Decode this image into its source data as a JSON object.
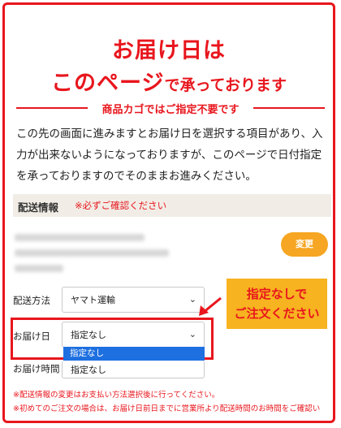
{
  "header": {
    "line1": "お届け日は",
    "line2_main": "このページ",
    "line2_small": "で承っております"
  },
  "divider": {
    "text": "商品カゴではご指定不要です"
  },
  "description": "この先の画面に進みますとお届け日を選択する項目があり、入力が出来ないようになっておりますが、このページで日付指定を承っておりますのでそのままお進みください。",
  "shipping_info": {
    "title": "配送情報",
    "note": "※必ずご確認ください",
    "change_button": "変更"
  },
  "form": {
    "method_label": "配送方法",
    "method_value": "ヤマト運輸",
    "date_label": "お届け日",
    "date_value": "指定なし",
    "date_option": "指定なし",
    "time_label": "お届け時間",
    "time_value": "指定なし"
  },
  "callout": {
    "line1": "指定なしで",
    "line2": "ご注文ください"
  },
  "notes": {
    "note1": "※配送情報の変更はお支払い方法選択後に行ってください。",
    "note2": "※初めてのご注文の場合は、お届け日前日までに営業所より配送時間のお時間をご確認い"
  },
  "colors": {
    "accent": "#e8161d",
    "button": "#f6a623",
    "callout_bg": "#f7b320",
    "selected": "#1e6fe0"
  }
}
